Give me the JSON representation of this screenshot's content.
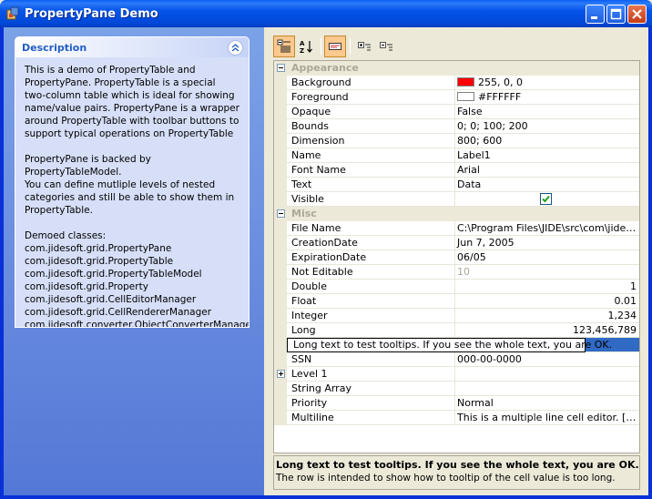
{
  "window": {
    "title": "PropertyPane Demo",
    "icons": [
      "app-icon",
      "minimize-icon",
      "maximize-icon",
      "close-icon"
    ]
  },
  "description_panel": {
    "title": "Description",
    "text": "This is a demo of PropertyTable and\nPropertyPane. PropertyTable is a special\ntwo-column table which is ideal for showing\nname/value pairs. PropertyPane is a wrapper\naround PropertyTable with toolbar buttons to\nsupport typical operations on PropertyTable\n\nPropertyPane is backed by PropertyTableModel.\nYou can define mutliple levels of nested\ncategories and still be able to show them in\nPropertyTable.\n\nDemoed classes:\ncom.jidesoft.grid.PropertyPane\ncom.jidesoft.grid.PropertyTable\ncom.jidesoft.grid.PropertyTableModel\ncom.jidesoft.grid.Property\ncom.jidesoft.grid.CellEditorManager\ncom.jidesoft.grid.CellRendererManager\ncom.jidesoft.converter.ObjectConverterManager"
  },
  "toolbar": {
    "buttons": [
      "categorized-view-icon",
      "sort-alphabetical-icon",
      "show-description-icon",
      "expand-all-icon",
      "collapse-all-icon"
    ],
    "active": [
      "categorized-view-icon",
      "show-description-icon"
    ]
  },
  "property_table": {
    "appearance": {
      "category": "Appearance",
      "rows": [
        {
          "name": "Background",
          "value": "255, 0, 0",
          "swatch": "#FF0000"
        },
        {
          "name": "Foreground",
          "value": "#FFFFFF",
          "swatch": "#FFFFFF"
        },
        {
          "name": "Opaque",
          "value": "False"
        },
        {
          "name": "Bounds",
          "value": "0; 0; 100; 200"
        },
        {
          "name": "Dimension",
          "value": "800; 600"
        },
        {
          "name": "Name",
          "value": "Label1"
        },
        {
          "name": "Font Name",
          "value": "Arial"
        },
        {
          "name": "Text",
          "value": "Data"
        },
        {
          "name": "Visible",
          "checked": true
        }
      ]
    },
    "misc": {
      "category": "Misc",
      "rows": [
        {
          "name": "File Name",
          "value": "C:\\Program Files\\JIDE\\src\\com\\jidesoft\\..."
        },
        {
          "name": "CreationDate",
          "value": "Jun 7, 2005"
        },
        {
          "name": "ExpirationDate",
          "value": "06/05"
        },
        {
          "name": "Not Editable",
          "value": "10"
        },
        {
          "name": "Double",
          "value": "1"
        },
        {
          "name": "Float",
          "value": "0.01"
        },
        {
          "name": "Integer",
          "value": "1,234"
        },
        {
          "name": "Long",
          "value": "123,456,789"
        },
        {
          "name": "Long text to test tooltips. If you see the whole text, you are OK.",
          "value": ""
        },
        {
          "name": "SSN",
          "value": "000-00-0000"
        },
        {
          "name": "Level 1",
          "value": ""
        },
        {
          "name": "String Array",
          "value": ""
        },
        {
          "name": "Priority",
          "value": "Normal"
        },
        {
          "name": "Multiline",
          "value": "This is a multiple line cell editor.  [...]"
        }
      ]
    }
  },
  "selected_property": {
    "title": "Long text to test tooltips. If you see the whole text, you are OK.",
    "description": "The row is intended to show how to tooltip of the cell value is too long."
  }
}
